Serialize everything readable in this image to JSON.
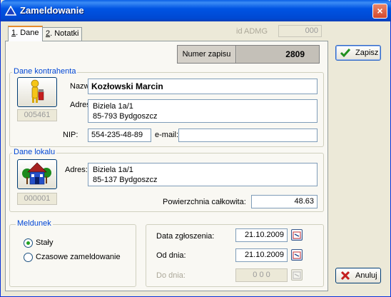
{
  "window": {
    "title": "Zameldowanie",
    "close_label": "×"
  },
  "tabs": [
    {
      "key": "1",
      "rest": ". Dane"
    },
    {
      "key": "2",
      "rest": ". Notatki"
    }
  ],
  "id_admg": {
    "label": "id ADMG",
    "value": "000"
  },
  "record": {
    "label": "Numer zapisu",
    "value": "2809"
  },
  "contractor": {
    "title": "Dane kontrahenta",
    "id_value": "005461",
    "name_label": "Nazwa:",
    "name_value": "Kozłowski Marcin",
    "address_label": "Adres",
    "address_line1": "Biziela 1a/1",
    "address_line2": "85-793 Bydgoszcz",
    "nip_label": "NIP:",
    "nip_value": "554-235-48-89",
    "email_label": "e-mail:",
    "email_value": ""
  },
  "premises": {
    "title": "Dane lokalu",
    "id_value": "000001",
    "address_label": "Adres:",
    "address_line1": "Biziela 1a/1",
    "address_line2": "85-137 Bydgoszcz",
    "area_label": "Powierzchnia całkowita:",
    "area_value": "48.63"
  },
  "registration": {
    "title": "Meldunek",
    "option_permanent": "Stały",
    "option_temporary": "Czasowe zameldowanie",
    "selected": "permanent"
  },
  "dates": {
    "filed_label": "Data zgłoszenia:",
    "filed_value": "21.10.2009",
    "from_label": "Od dnia:",
    "from_value": "21.10.2009",
    "to_label": "Do dnia:",
    "to_value": "0 0 0"
  },
  "buttons": {
    "save": "Zapisz",
    "cancel": "Anuluj"
  }
}
